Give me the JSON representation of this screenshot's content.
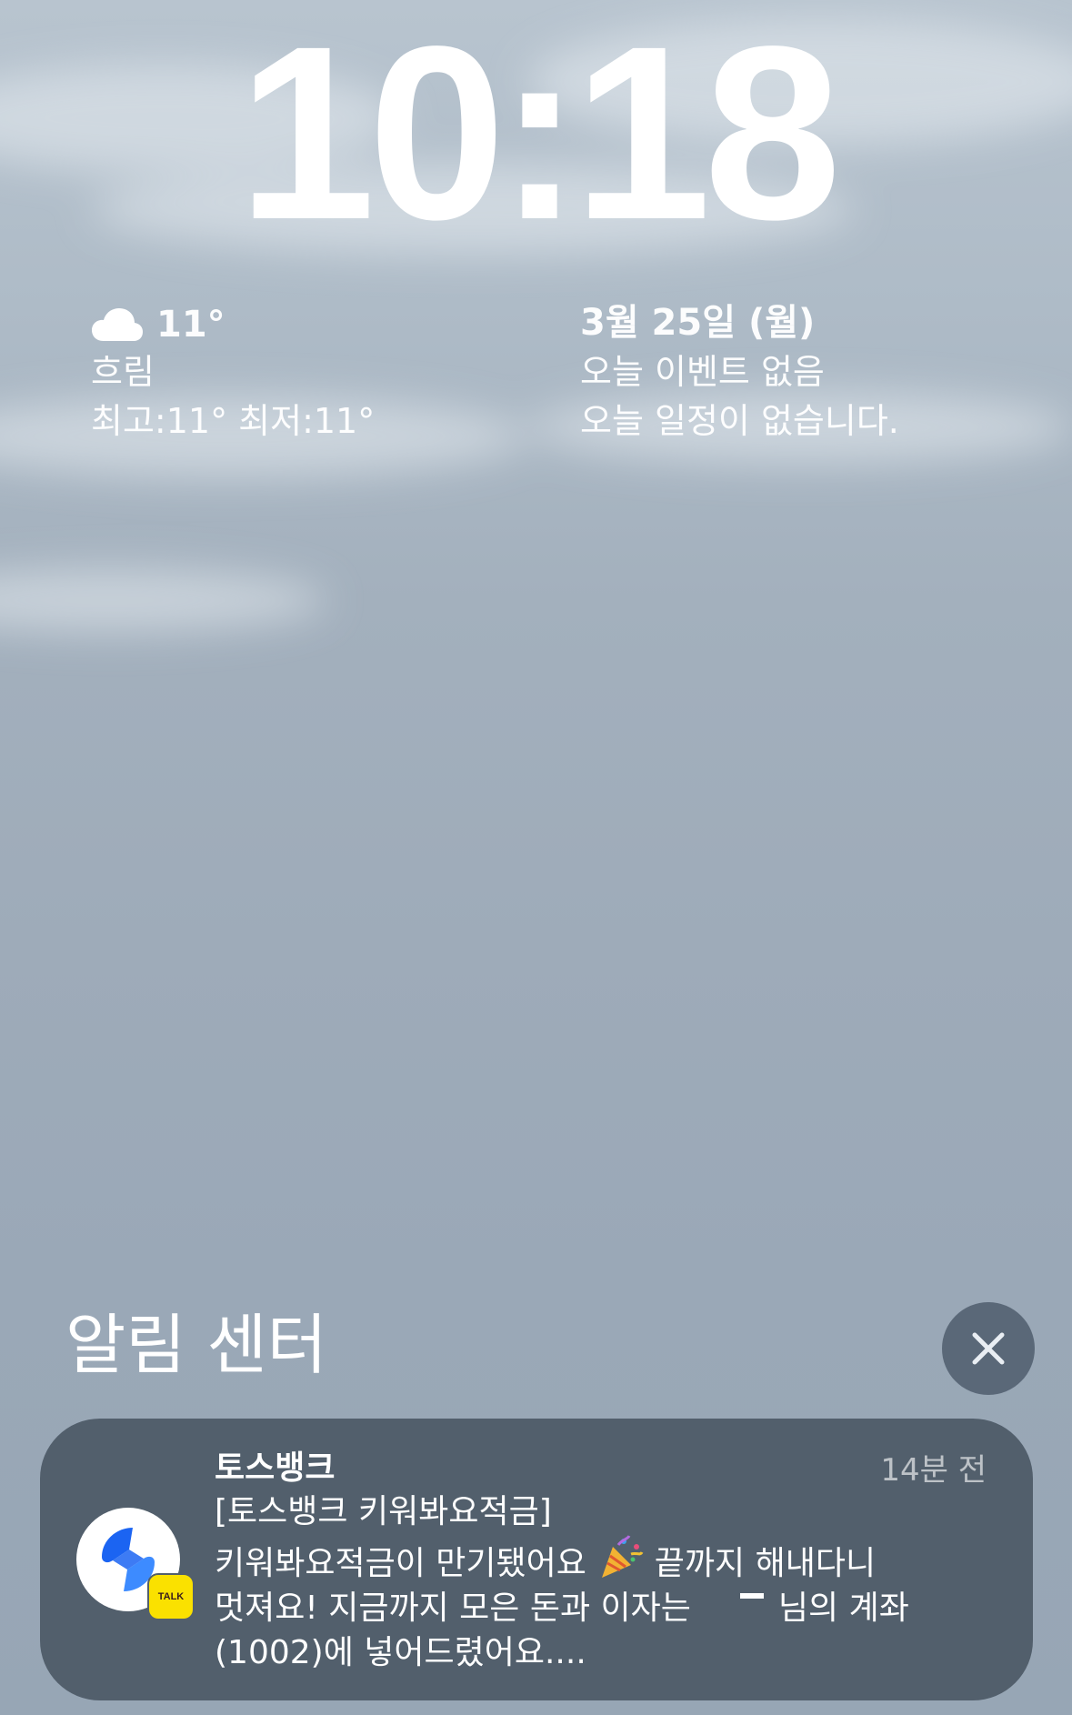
{
  "lock_screen": {
    "time": "10:18",
    "weather": {
      "icon": "cloud-icon",
      "temperature": "11°",
      "condition": "흐림",
      "high_low": "최고:11° 최저:11°"
    },
    "calendar": {
      "date": "3월 25일 (월)",
      "event_line": "오늘 이벤트 없음",
      "schedule_line": "오늘 일정이 없습니다."
    }
  },
  "notification_center": {
    "title": "알림 센터",
    "clear_icon": "close-icon"
  },
  "notification": {
    "app_icon": "toss-bank-icon",
    "badge_icon": "kakaotalk-badge-icon",
    "badge_text": "TALK",
    "sender": "토스뱅크",
    "time": "14분 전",
    "line1": "[토스뱅크 키워봐요적금]",
    "line2_a": "키워봐요적금이 만기됐어요",
    "emoji_icon": "party-popper-icon",
    "line2_b": "끝까지 해내다니",
    "line3_a": "멋져요! 지금까지 모은 돈과 이자는",
    "line3_b": "님의 계좌",
    "line4": "(1002)에 넣어드렸어요...."
  },
  "colors": {
    "card_background": "#525f6c",
    "close_button": "#5a6878",
    "kakao_yellow": "#fae100",
    "toss_blue": "#1b64f2"
  }
}
